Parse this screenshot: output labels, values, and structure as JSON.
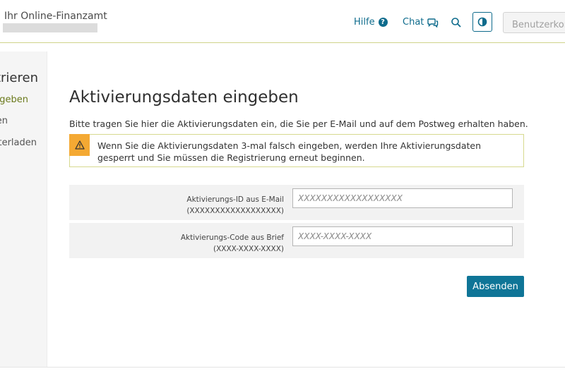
{
  "header": {
    "brand": "Ihr Online-Finanzamt",
    "help_label": "Hilfe",
    "help_badge": "?",
    "chat_label": "Chat",
    "account_label": "Benutzerkonto"
  },
  "sidebar": {
    "title": "Registrieren",
    "items": [
      {
        "label": "Daten eingeben",
        "active": true
      },
      {
        "label": "Prüfen",
        "active": false
      },
      {
        "label": "Zertifikat herunterladen",
        "active": false
      }
    ]
  },
  "main": {
    "title": "Aktivierungsdaten eingeben",
    "intro": "Bitte tragen Sie hier die Aktivierungsdaten ein, die Sie per E-Mail und auf dem Postweg erhalten haben.",
    "warning": "Wenn Sie die Aktivierungsdaten 3-mal falsch eingeben, werden Ihre Aktivierungsdaten gesperrt und Sie müssen die Registrierung erneut beginnen.",
    "fields": [
      {
        "label": "Aktivierungs-ID aus E-Mail",
        "hint": "(XXXXXXXXXXXXXXXXXX)",
        "placeholder": "XXXXXXXXXXXXXXXXXX",
        "value": ""
      },
      {
        "label": "Aktivierungs-Code aus Brief",
        "hint": "(XXXX-XXXX-XXXX)",
        "placeholder": "XXXX-XXXX-XXXX",
        "value": ""
      }
    ],
    "submit_label": "Absenden"
  },
  "colors": {
    "accent": "#0f7597",
    "link": "#0e6b8c",
    "active_nav": "#6b7a1c",
    "warning": "#f4a933",
    "warning_border": "#d6d98f"
  }
}
